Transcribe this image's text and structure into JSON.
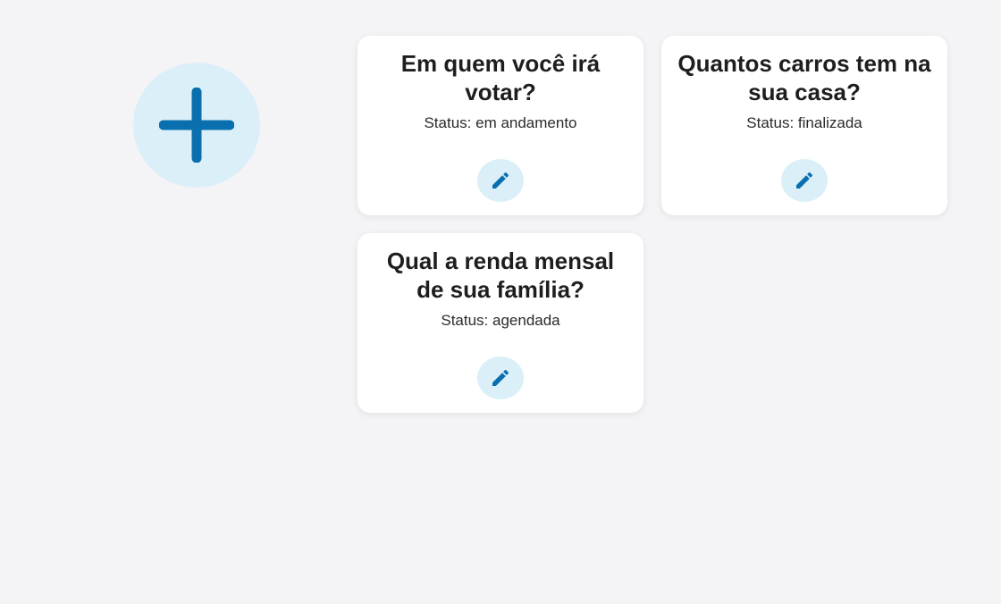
{
  "add_button": {
    "icon": "plus-icon",
    "color": "#0a6fae",
    "background": "#dbeff8"
  },
  "surveys": [
    {
      "title": "Em quem você irá votar?",
      "status": "Status: em andamento",
      "edit_icon": "pencil-icon"
    },
    {
      "title": "Quantos carros tem na sua casa?",
      "status": "Status: finalizada",
      "edit_icon": "pencil-icon"
    },
    {
      "title": "Qual a renda mensal de sua família?",
      "status": "Status: agendada",
      "edit_icon": "pencil-icon"
    }
  ],
  "colors": {
    "background": "#f4f4f6",
    "card": "#ffffff",
    "accent": "#0a6fae",
    "accent_light": "#dbeff8",
    "text": "#1e1e1e"
  }
}
